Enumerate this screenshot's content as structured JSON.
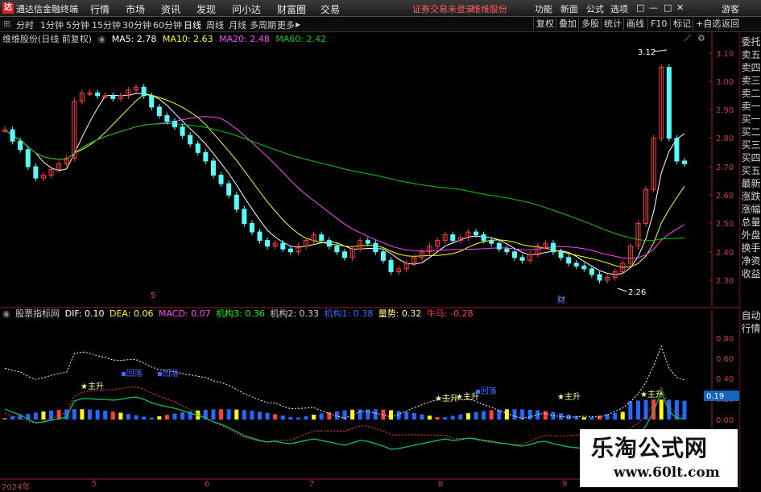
{
  "menubar": {
    "app_title": "通达信金融终端",
    "items": [
      "行情",
      "市场",
      "资讯",
      "发现",
      "问小达",
      "财富圈",
      "交易"
    ],
    "notice": "证券交易未登录",
    "stock_name": "维维股份",
    "right_items": [
      "功能",
      "新面",
      "公式",
      "选项"
    ],
    "guest": "游客",
    "window_controls": [
      "□",
      "—",
      "□",
      "✕"
    ]
  },
  "periodbar": {
    "periods": [
      "分时",
      "1分钟",
      "5分钟",
      "15分钟",
      "30分钟",
      "60分钟",
      "日线",
      "周线",
      "月线",
      "多周期",
      "更多"
    ],
    "active": "日线",
    "tools": [
      "复权",
      "叠加",
      "多股",
      "统计",
      "画线",
      "F10",
      "标记",
      "+自选",
      "返回"
    ]
  },
  "chart_header": {
    "title": "维维股份(日线 前复权)",
    "ma5": "MA5: 2.78",
    "ma10": "MA10: 2.63",
    "ma20": "MA20: 2.48",
    "ma60": "MA60: 2.42"
  },
  "price_axis": [
    "3.10",
    "3.00",
    "2.90",
    "2.80",
    "2.70",
    "2.60",
    "2.50",
    "2.40",
    "2.30"
  ],
  "price_annotations": {
    "high": "3.12",
    "low": "2.26",
    "mark_5": "5",
    "mark_cai": "财"
  },
  "sidebar": {
    "items": [
      "委托",
      "卖五",
      "卖四",
      "卖三",
      "卖二",
      "卖一",
      "买一",
      "买二",
      "买三",
      "买四",
      "买五",
      "最新",
      "涨跌",
      "涨幅",
      "总量",
      "外盘",
      "换手",
      "净资",
      "收益"
    ],
    "bottom_items": [
      "自动",
      "行情"
    ]
  },
  "indicator_header": {
    "name": "股票指标网",
    "dif": "DIF: 0.10",
    "dea": "DEA: 0.06",
    "macd": "MACD: 0.07",
    "jg3": "机构3: 0.36",
    "jg2": "机构2: 0.33",
    "jg1": "机构1: 0.38",
    "liangshi": "量势: 0.32",
    "niuma": "牛马: -0.28"
  },
  "indicator_axis": [
    "0.80",
    "0.60",
    "0.40",
    "0.20",
    "0.00"
  ],
  "indicator_value_box": "0.19",
  "indicator_labels": [
    "主升",
    "主升",
    "主升",
    "主升",
    "主升",
    "回落",
    "回落",
    "回落"
  ],
  "date_axis": [
    "2024年",
    "5",
    "6",
    "7",
    "8",
    "9"
  ],
  "watermark": {
    "line1": "乐淘公式网",
    "line2": "www.60lt.com"
  },
  "colors": {
    "up": "#ff3c3c",
    "down": "#54ffff",
    "ma5": "#ffffff",
    "ma10": "#ffff00",
    "ma20": "#ff44ff",
    "ma60": "#00cc00",
    "axis": "#a02020"
  }
}
